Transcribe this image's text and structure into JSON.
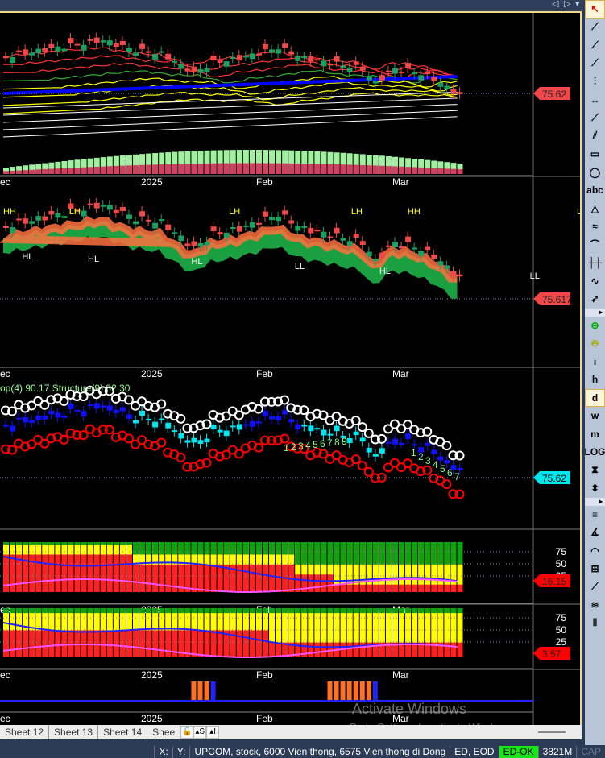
{
  "window": {
    "nav_prev": "◁",
    "nav_next": "▷",
    "nav_menu": "▾"
  },
  "panels": {
    "price": {
      "last": "75.62",
      "axis": [
        "ec",
        "2025",
        "Feb",
        "Mar"
      ]
    },
    "structure": {
      "last": "75.617",
      "axis": [
        "ec",
        "2025",
        "Feb",
        "Mar"
      ],
      "labels": [
        {
          "t": "HH",
          "i": 0
        },
        {
          "t": "LH",
          "i": 7
        },
        {
          "t": "HL",
          "i": 2
        },
        {
          "t": "HL",
          "i": 9
        },
        {
          "t": "HL",
          "i": 20
        },
        {
          "t": "LH",
          "i": 24
        },
        {
          "t": "LL",
          "i": 31
        },
        {
          "t": "LH",
          "i": 37
        },
        {
          "t": "HL",
          "i": 40
        },
        {
          "t": "HH",
          "i": 43
        },
        {
          "t": "LL",
          "i": 56
        },
        {
          "t": "LH",
          "i": 61
        }
      ]
    },
    "swing": {
      "title": "op(4) 90.17 Structure(9) 82.30",
      "last": "75.62",
      "counts": [
        "1",
        "2",
        "3",
        "4",
        "5",
        "6",
        "7",
        "8",
        "9",
        "1",
        "2",
        "3",
        "4",
        "5",
        "6",
        "7"
      ]
    },
    "osc1": {
      "last": "16.15",
      "levels": [
        "75",
        "50",
        "25"
      ],
      "axis": [
        "ec",
        "2025",
        "Feb",
        "Mar"
      ]
    },
    "osc2": {
      "last": "3.57",
      "levels": [
        "75",
        "50",
        "25"
      ],
      "axis": [
        "ec",
        "2025",
        "Feb",
        "Mar"
      ]
    },
    "bars": {
      "axis": [
        "ec",
        "2025",
        "Feb",
        "Mar"
      ]
    }
  },
  "tabs": [
    "Sheet 12",
    "Sheet 13",
    "Sheet 14",
    "Shee"
  ],
  "tab_buttons": [
    "🔓",
    "▴S",
    "▴I"
  ],
  "status": {
    "x": "X:",
    "y": "Y:",
    "symbol": "UPCOM, stock, 6000 Vien thong, 6575 Vien thong di Dong",
    "mode": "ED, EOD",
    "ok": "ED-OK",
    "mem": "3821M",
    "cap": "CAP"
  },
  "toolbar": [
    "↖",
    "⟋",
    "⟋",
    "⟋",
    "⫶",
    "↔",
    "⟋",
    "⫽",
    "▭",
    "◯",
    "abc",
    "△",
    "≈",
    "⌒",
    "┼┼",
    "∿",
    "➶",
    "▸",
    "⊕",
    "⊖",
    "i",
    "h",
    "d",
    "w",
    "m",
    "LOG",
    "⧗",
    "⬍",
    "▸",
    "≡",
    "∡",
    "◠",
    "⊞",
    "⟋",
    "≋",
    "⦀"
  ],
  "watermark": {
    "title": "Activate Windows",
    "sub": "Go to Settings to activate Windows."
  },
  "colors": {
    "bg": "#000000",
    "bull": "#1aa060",
    "bear": "#f04848",
    "blue": "#0000ff",
    "cyan": "#00e5ee",
    "yellow": "#ffff00",
    "label_red": "#f04848",
    "label_cyan": "#00e5ee"
  }
}
